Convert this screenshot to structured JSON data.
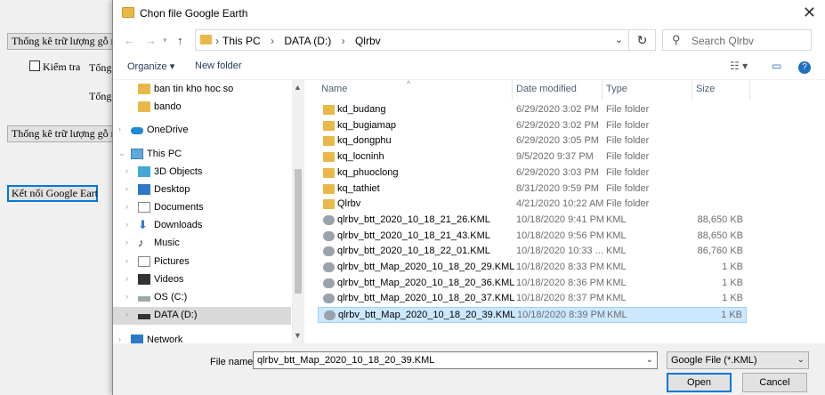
{
  "background_app": {
    "btn1": "Thống kê trữ lượng gỗ rừng t",
    "checkbox_label": "Kiểm tra",
    "label_tong1": "Tổng c",
    "label_tong2": "Tổng k",
    "btn2": "Thống kê trữ lượng gỗ rừng t",
    "btn3": "Kết nối Google Earth"
  },
  "dialog": {
    "title": "Chọn file Google Earth",
    "close_glyph": "✕",
    "address": {
      "crumbs": [
        "This PC",
        "DATA (D:)",
        "Qlrbv"
      ],
      "sep": "›"
    },
    "search_placeholder": "Search Qlrbv",
    "toolbar": {
      "organize": "Organize ▾",
      "new_folder": "New folder"
    },
    "nav_items": [
      {
        "label": "ban tin kho hoc so",
        "icon": "folder-icon"
      },
      {
        "label": "bando",
        "icon": "folder-icon"
      },
      {
        "label": "OneDrive",
        "icon": "cloud-icon"
      },
      {
        "label": "This PC",
        "icon": "pc-icon"
      },
      {
        "label": "3D Objects",
        "icon": "3d-objects-icon"
      },
      {
        "label": "Desktop",
        "icon": "desktop-icon"
      },
      {
        "label": "Documents",
        "icon": "documents-icon"
      },
      {
        "label": "Downloads",
        "icon": "downloads-icon"
      },
      {
        "label": "Music",
        "icon": "music-icon"
      },
      {
        "label": "Pictures",
        "icon": "pictures-icon"
      },
      {
        "label": "Videos",
        "icon": "videos-icon"
      },
      {
        "label": "OS (C:)",
        "icon": "drive-icon"
      },
      {
        "label": "DATA (D:)",
        "icon": "drive-icon"
      },
      {
        "label": "Network",
        "icon": "network-icon"
      }
    ],
    "columns": {
      "name": "Name",
      "date": "Date modified",
      "type": "Type",
      "size": "Size"
    },
    "files": [
      {
        "name": "kd_budang",
        "date": "6/29/2020 3:02 PM",
        "type": "File folder",
        "size": "",
        "kind": "folder"
      },
      {
        "name": "kq_bugiamap",
        "date": "6/29/2020 3:02 PM",
        "type": "File folder",
        "size": "",
        "kind": "folder"
      },
      {
        "name": "kq_dongphu",
        "date": "6/29/2020 3:05 PM",
        "type": "File folder",
        "size": "",
        "kind": "folder"
      },
      {
        "name": "kq_locninh",
        "date": "9/5/2020 9:37 PM",
        "type": "File folder",
        "size": "",
        "kind": "folder"
      },
      {
        "name": "kq_phuoclong",
        "date": "6/29/2020 3:03 PM",
        "type": "File folder",
        "size": "",
        "kind": "folder"
      },
      {
        "name": "kq_tathiet",
        "date": "8/31/2020 9:59 PM",
        "type": "File folder",
        "size": "",
        "kind": "folder"
      },
      {
        "name": "Qlrbv",
        "date": "4/21/2020 10:22 AM",
        "type": "File folder",
        "size": "",
        "kind": "folder"
      },
      {
        "name": "qlrbv_btt_2020_10_18_21_26.KML",
        "date": "10/18/2020 9:41 PM",
        "type": "KML",
        "size": "88,650 KB",
        "kind": "kml"
      },
      {
        "name": "qlrbv_btt_2020_10_18_21_43.KML",
        "date": "10/18/2020 9:56 PM",
        "type": "KML",
        "size": "88,650 KB",
        "kind": "kml"
      },
      {
        "name": "qlrbv_btt_2020_10_18_22_01.KML",
        "date": "10/18/2020 10:33 ...",
        "type": "KML",
        "size": "86,760 KB",
        "kind": "kml"
      },
      {
        "name": "qlrbv_btt_Map_2020_10_18_20_29.KML",
        "date": "10/18/2020 8:33 PM",
        "type": "KML",
        "size": "1 KB",
        "kind": "kml"
      },
      {
        "name": "qlrbv_btt_Map_2020_10_18_20_36.KML",
        "date": "10/18/2020 8:36 PM",
        "type": "KML",
        "size": "1 KB",
        "kind": "kml"
      },
      {
        "name": "qlrbv_btt_Map_2020_10_18_20_37.KML",
        "date": "10/18/2020 8:37 PM",
        "type": "KML",
        "size": "1 KB",
        "kind": "kml"
      },
      {
        "name": "qlrbv_btt_Map_2020_10_18_20_39.KML",
        "date": "10/18/2020 8:39 PM",
        "type": "KML",
        "size": "1 KB",
        "kind": "kml",
        "selected": true
      }
    ],
    "file_name_label": "File name:",
    "file_name_value": "qlrbv_btt_Map_2020_10_18_20_39.KML",
    "file_type": "Google File  (*.KML)",
    "open_label": "Open",
    "cancel_label": "Cancel"
  }
}
